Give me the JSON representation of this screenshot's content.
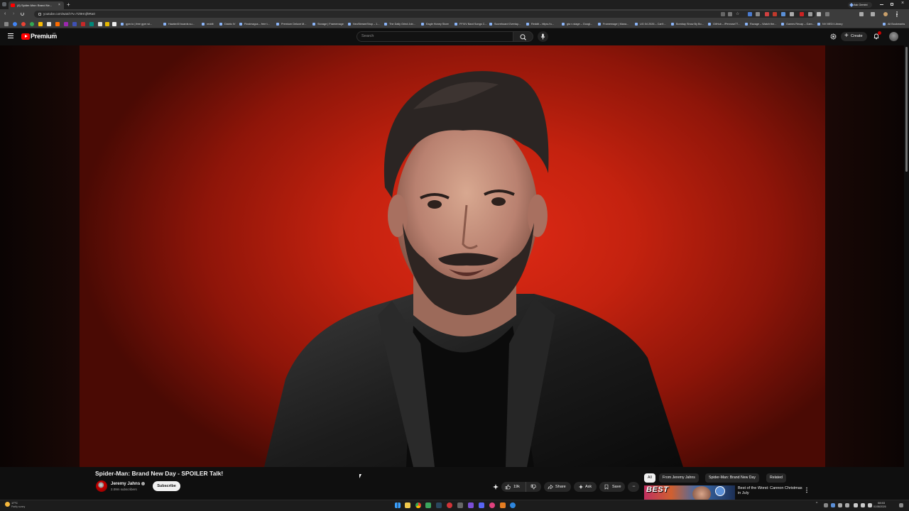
{
  "browser": {
    "tab_title": "(4) Spider-Man: Brand Ne...",
    "url": "youtube.com/watch?v=TZ9Hnjf9Ra0",
    "ask_gemini": "Ask Gemini",
    "bookmarks": [
      "gym.to | free gym wi...",
      "Hawke40 boards su...",
      "reddit",
      "Diablo IV",
      "Finalmagus – free t...",
      "Premium Deluxe M...",
      "Storage | Framemage",
      "NeoStreamShop – 1...",
      "The Daily Grind Job...",
      "Eagle Honey Store",
      "FFXIV Bard Songs C...",
      "Scoreboard Overlay...",
      "Reddit – https://u...",
      "gta v stage – Googl...",
      "Framemage | Mana...",
      "UG 04 2026 – Can't...",
      "Bombay Show By Bo...",
      "GitHub – iPenrose77...",
      "Ravage – Watch the...",
      "Games Recap – Gam...",
      "NV MEDI Library"
    ],
    "all_bookmarks": "All Bookmarks"
  },
  "header": {
    "logo_text": "Premium",
    "logo_superscript": "GB",
    "search_placeholder": "Search",
    "create_label": "Create"
  },
  "video": {
    "title": "Spider-Man: Brand New Day - SPOILER Talk!",
    "channel_name": "Jeremy Jahns",
    "subscribers": "2.09m subscribers",
    "subscribe_label": "Subscribe",
    "like_count": "19k",
    "share_label": "Share",
    "ask_label": "Ask",
    "save_label": "Save"
  },
  "related": {
    "chips": [
      "All",
      "From Jeremy Jahns",
      "Spider-Man: Brand New Day",
      "Related"
    ],
    "first_title": "Best of the Worst: Cannon Christmas in July",
    "thumb_text": "BEST"
  },
  "taskbar": {
    "weather_temp": "17°C",
    "weather_desc": "Partly sunny",
    "time": "08:53",
    "date": "01/08/2026"
  },
  "colors": {
    "accent": "#ff0000",
    "background": "#0f0f0f",
    "video_red": "#c4220f"
  }
}
